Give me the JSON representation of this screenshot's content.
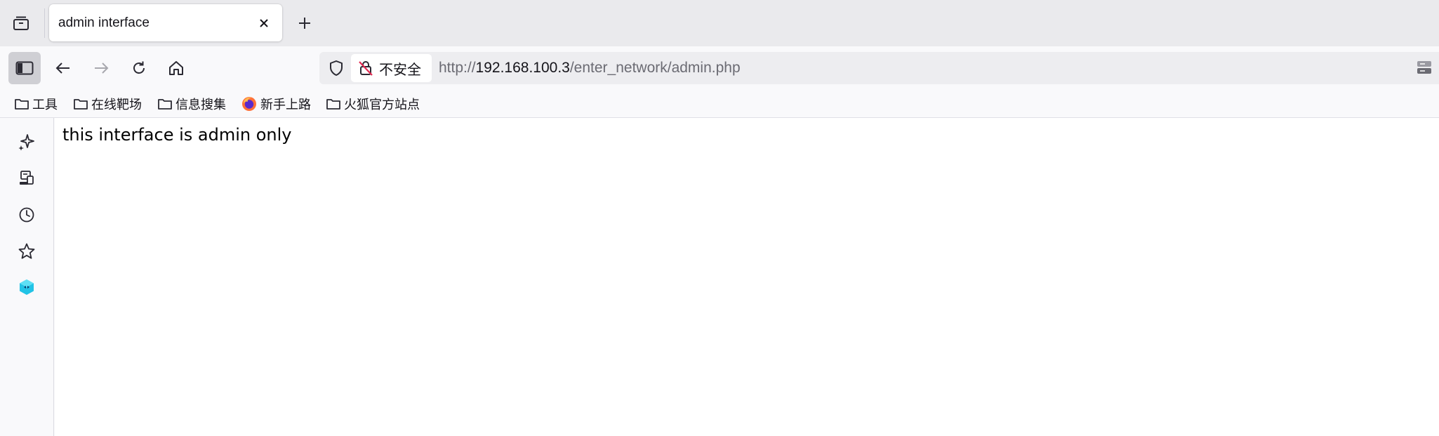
{
  "tab": {
    "title": "admin interface",
    "close_icon": "close-icon",
    "new_tab_icon": "plus-icon"
  },
  "urlbar": {
    "security_label": "不安全",
    "url_scheme": "http://",
    "url_host": "192.168.100.3",
    "url_path": "/enter_network/admin.php"
  },
  "bookmarks": [
    {
      "label": "工具",
      "icon": "folder-icon"
    },
    {
      "label": "在线靶场",
      "icon": "folder-icon"
    },
    {
      "label": "信息搜集",
      "icon": "folder-icon"
    },
    {
      "label": "新手上路",
      "icon": "firefox-icon"
    },
    {
      "label": "火狐官方站点",
      "icon": "folder-icon"
    }
  ],
  "sidebar": {
    "icons": [
      "ai-sparkle-icon",
      "synced-tabs-icon",
      "history-icon",
      "bookmarks-star-icon",
      "extension-cube-icon"
    ]
  },
  "page": {
    "message": "this interface is admin only"
  },
  "colors": {
    "tabstrip_bg": "#eaeaed",
    "toolbar_bg": "#f9f9fb",
    "urlbar_bg": "#ededf0",
    "active_sidebar_toggle": "#cfcfd4",
    "insecure_red": "#e22850",
    "extension_cyan": "#22c3e6"
  }
}
